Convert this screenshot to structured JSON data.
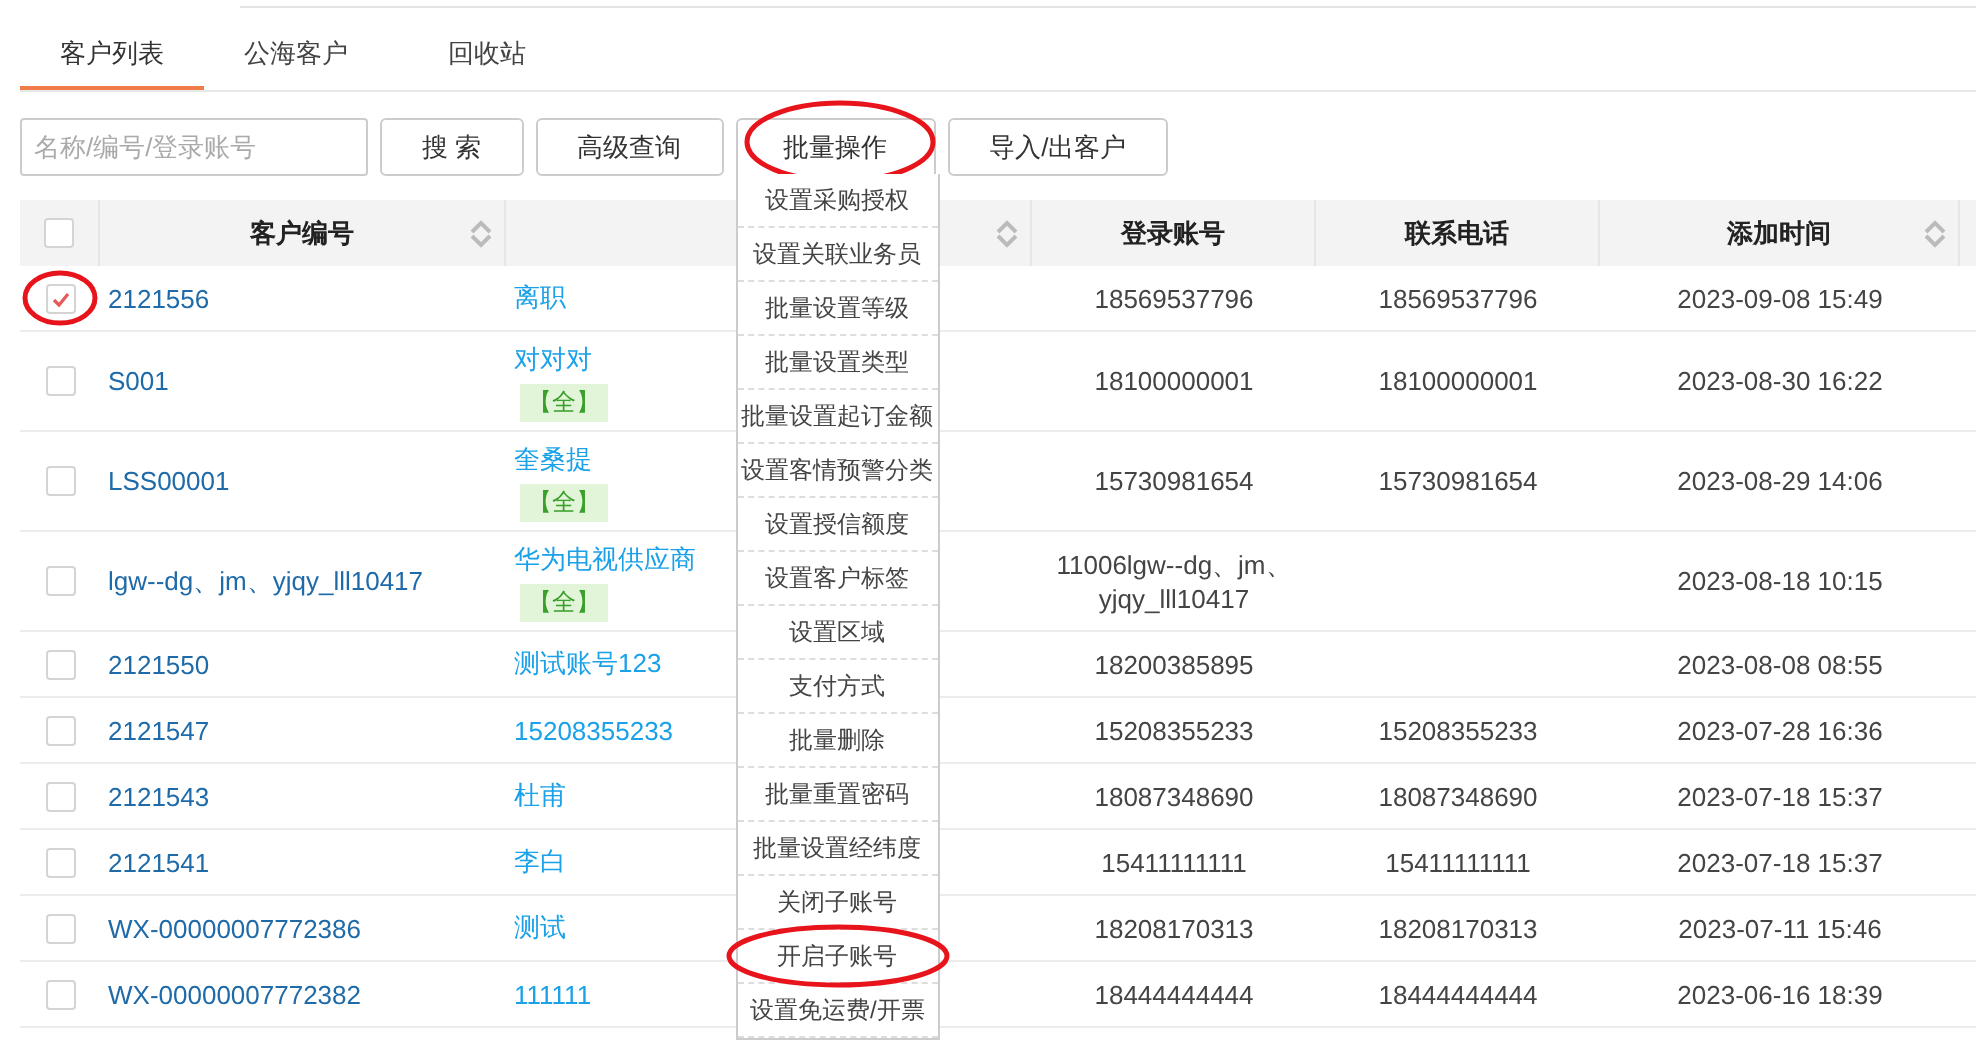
{
  "tabs": [
    {
      "label": "客户列表",
      "selected": true
    },
    {
      "label": "公海客户",
      "selected": false
    },
    {
      "label": "回收站",
      "selected": false
    }
  ],
  "toolbar": {
    "search": {
      "placeholder": "名称/编号/登录账号"
    },
    "buttons": [
      {
        "label": "搜 索",
        "kind": "plain",
        "circled": false
      },
      {
        "label": "高级查询",
        "kind": "plain",
        "circled": false
      },
      {
        "label": "批量操作",
        "kind": "menu",
        "circled": true
      },
      {
        "label": "导入/出客户",
        "kind": "plain",
        "circled": false
      }
    ]
  },
  "batch_menu": [
    {
      "label": "设置采购授权",
      "circled": false
    },
    {
      "label": "设置关联业务员",
      "circled": false
    },
    {
      "label": "批量设置等级",
      "circled": false
    },
    {
      "label": "批量设置类型",
      "circled": false
    },
    {
      "label": "批量设置起订金额",
      "circled": false
    },
    {
      "label": "设置客情预警分类",
      "circled": false
    },
    {
      "label": "设置授信额度",
      "circled": false
    },
    {
      "label": "设置客户标签",
      "circled": false
    },
    {
      "label": "设置区域",
      "circled": false
    },
    {
      "label": "支付方式",
      "circled": false
    },
    {
      "label": "批量删除",
      "circled": false
    },
    {
      "label": "批量重置密码",
      "circled": false
    },
    {
      "label": "批量设置经纬度",
      "circled": false
    },
    {
      "label": "关闭子账号",
      "circled": false
    },
    {
      "label": "开启子账号",
      "circled": true
    },
    {
      "label": "设置免运费/开票",
      "circled": false
    }
  ],
  "table": {
    "all_checked": false,
    "columns": [
      {
        "label": "客户编号",
        "sortable": true
      },
      {
        "sortable": true
      },
      {
        "label": "登录账号",
        "sortable": false
      },
      {
        "label": "联系电话",
        "sortable": false
      },
      {
        "label": "添加时间",
        "sortable": true
      }
    ],
    "rows": [
      {
        "checked": true,
        "circled": true,
        "id": "2121556",
        "name": "离职",
        "login": "18569537796",
        "phone": "18569537796",
        "time": "2023-09-08 15:49"
      },
      {
        "checked": false,
        "circled": false,
        "id": "S001",
        "name": "对对对",
        "tag": "【全】",
        "login": "18100000001",
        "phone": "18100000001",
        "time": "2023-08-30 16:22"
      },
      {
        "checked": false,
        "circled": false,
        "id": "LSS00001",
        "name": "奎桑提",
        "tag": "【全】",
        "login": "15730981654",
        "phone": "15730981654",
        "time": "2023-08-29 14:06"
      },
      {
        "checked": false,
        "circled": false,
        "id": "lgw--dg、jm、yjqy_lll10417",
        "name": "华为电视供应商",
        "tag": "【全】",
        "login": "11006lgw--dg、jm、yjqy_lll10417",
        "time": "2023-08-18 10:15"
      },
      {
        "checked": false,
        "circled": false,
        "id": "2121550",
        "name": "测试账号123",
        "login": "18200385895",
        "time": "2023-08-08 08:55"
      },
      {
        "checked": false,
        "circled": false,
        "id": "2121547",
        "name": "15208355233",
        "login": "15208355233",
        "phone": "15208355233",
        "time": "2023-07-28 16:36"
      },
      {
        "checked": false,
        "circled": false,
        "id": "2121543",
        "name": "杜甫",
        "login": "18087348690",
        "phone": "18087348690",
        "time": "2023-07-18 15:37"
      },
      {
        "checked": false,
        "circled": false,
        "id": "2121541",
        "name": "李白",
        "login": "15411111111",
        "phone": "15411111111",
        "time": "2023-07-18 15:37"
      },
      {
        "checked": false,
        "circled": false,
        "id": "WX-00000007772386",
        "name": "测试",
        "login": "18208170313",
        "phone": "18208170313",
        "time": "2023-07-11 15:46"
      },
      {
        "checked": false,
        "circled": false,
        "id": "WX-00000007772382",
        "name": "111111",
        "login": "18444444444",
        "phone": "18444444444",
        "time": "2023-06-16 18:39"
      }
    ]
  }
}
